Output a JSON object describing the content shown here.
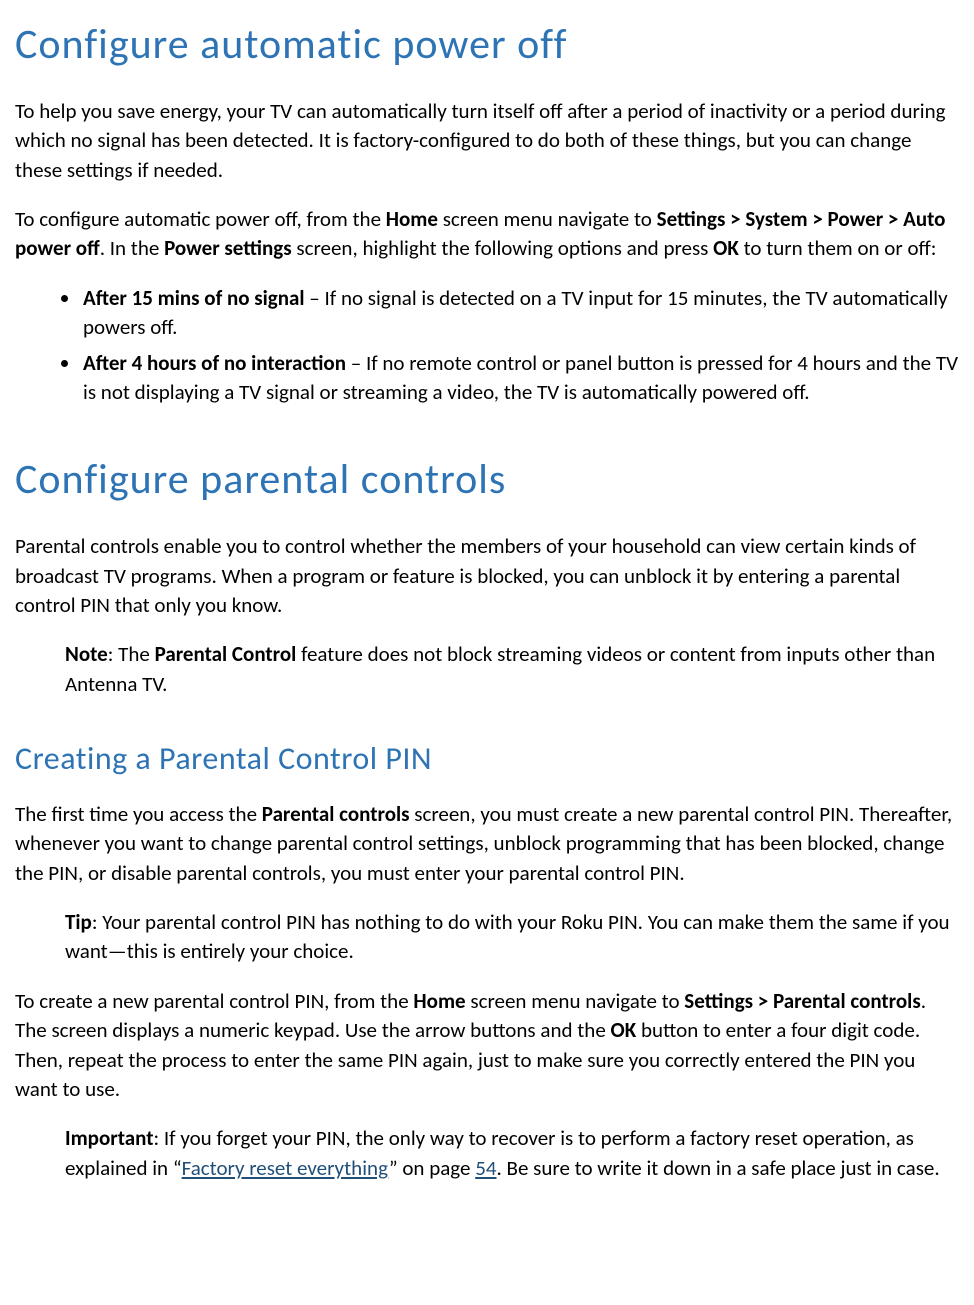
{
  "colors": {
    "heading": "#2E74B5",
    "link": "#1F4E79"
  },
  "sec1": {
    "title": "Configure automatic power off",
    "p1a": "To help you save energy, your TV can automatically turn itself off after a period of inactivity or a period during which no signal has been detected. It is factory-configured to do both of these things, but you can change these settings if needed.",
    "p2_1": "To configure automatic power off, from the ",
    "p2_b1": "Home",
    "p2_2": " screen menu navigate to ",
    "p2_b2": "Settings > System > Power > Auto power off",
    "p2_3": ". In the ",
    "p2_b3": "Power settings",
    "p2_4": " screen, highlight the following options and press ",
    "p2_b4": "OK",
    "p2_5": " to turn them on or off:",
    "li1_b": "After 15 mins of no signal",
    "li1_t": " – If no signal is detected on a TV input for 15 minutes, the TV automatically powers off.",
    "li2_b": "After 4 hours of no interaction",
    "li2_t": " – If no remote control or panel button is pressed for 4 hours and the TV is not displaying a TV signal or streaming a video, the TV is automatically powered off."
  },
  "sec2": {
    "title": "Configure parental controls",
    "p1": "Parental controls enable you to control whether the members of your household can view certain kinds of broadcast TV programs. When a program or feature is blocked, you can unblock it by entering a parental control PIN that only you know.",
    "note_b": "Note",
    "note_1": ": The ",
    "note_pc": "Parental Control",
    "note_2": " feature does not block streaming videos or content from inputs other than Antenna TV."
  },
  "sec3": {
    "title": "Creating a Parental Control PIN",
    "p1_1": "The first time you access the ",
    "p1_b1": "Parental controls",
    "p1_2": " screen, you must create a new parental control PIN. Thereafter, whenever you want to change parental control settings, unblock programming that has been blocked, change the PIN, or disable parental controls, you must enter your parental control PIN.",
    "tip_b": "Tip",
    "tip_t": ": Your parental control PIN has nothing to do with your Roku PIN. You can make them the same if you want—this is entirely your choice.",
    "p2_1": "To create a new parental control PIN, from the ",
    "p2_b1": "Home",
    "p2_2": " screen menu navigate to ",
    "p2_b2": "Settings > Parental controls",
    "p2_3": ". The screen displays a numeric keypad. Use the arrow buttons and the ",
    "p2_b3": "OK",
    "p2_4": " button to enter a four digit code. Then, repeat the process to enter the same PIN again, just to make sure you correctly entered the PIN you want to use.",
    "imp_b": "Important",
    "imp_1": ": If you forget your PIN, the only way to recover is to perform a factory reset operation, as explained in “",
    "imp_link1": "Factory reset everything",
    "imp_2": "” on page ",
    "imp_link2": "54",
    "imp_3": ". Be sure to write it down in a safe place just in case."
  }
}
